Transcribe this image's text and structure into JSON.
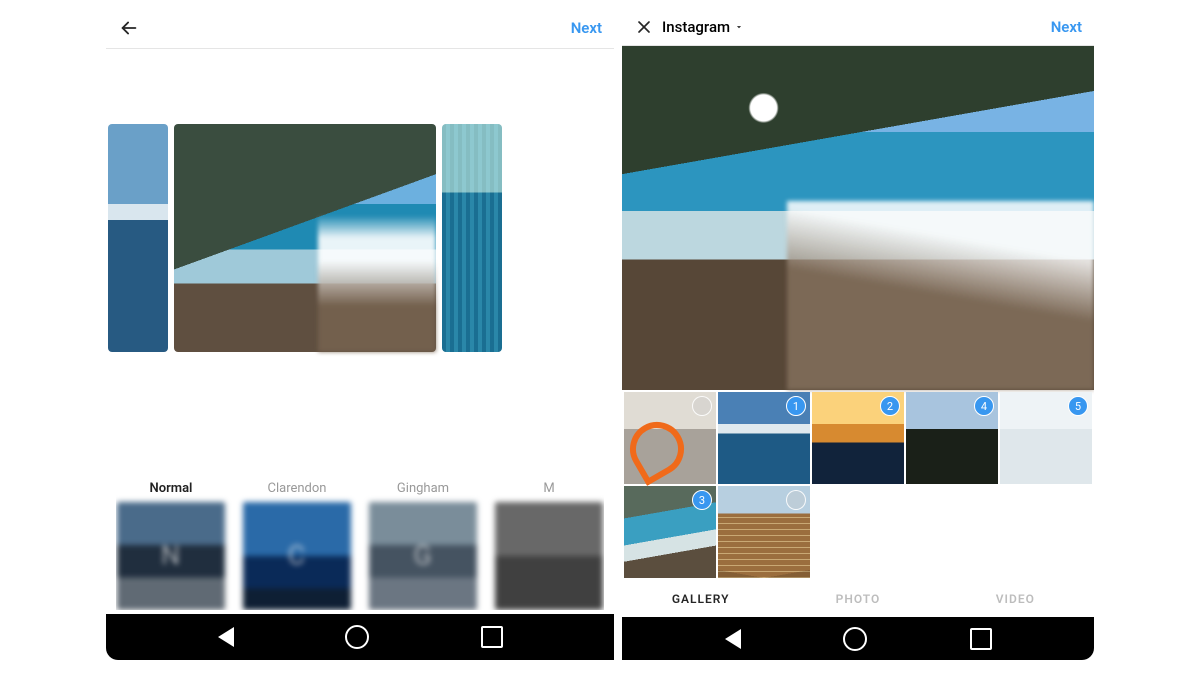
{
  "left": {
    "next": "Next",
    "filters": [
      {
        "label": "Normal",
        "letter": "N",
        "cls": "f-normal",
        "selected": true
      },
      {
        "label": "Clarendon",
        "letter": "C",
        "cls": "f-clar",
        "selected": false
      },
      {
        "label": "Gingham",
        "letter": "G",
        "cls": "f-ging",
        "selected": false
      },
      {
        "label": "M",
        "letter": "",
        "cls": "f-m",
        "selected": false
      }
    ]
  },
  "right": {
    "title": "Instagram",
    "next": "Next",
    "tabs": [
      {
        "label": "GALLERY",
        "active": true
      },
      {
        "label": "PHOTO",
        "active": false
      },
      {
        "label": "VIDEO",
        "active": false
      }
    ],
    "tiles": [
      {
        "cls": "tile1",
        "badge": ""
      },
      {
        "cls": "tile2",
        "badge": "1"
      },
      {
        "cls": "tile3",
        "badge": "2"
      },
      {
        "cls": "tile4",
        "badge": "4"
      },
      {
        "cls": "tile5",
        "badge": "5"
      },
      {
        "cls": "tile6",
        "badge": "3"
      },
      {
        "cls": "tile7",
        "badge": ""
      }
    ]
  },
  "accent": "#3897f0"
}
